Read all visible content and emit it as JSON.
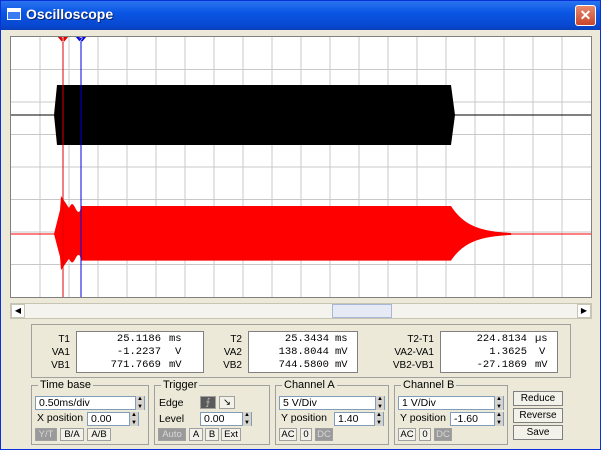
{
  "window": {
    "title": "Oscilloscope",
    "close": "✕"
  },
  "cursors": {
    "c1": "1",
    "c2": "2"
  },
  "readout": {
    "t1": {
      "labels": [
        "T1",
        "VA1",
        "VB1"
      ],
      "values": [
        [
          "25.1186",
          "ms"
        ],
        [
          "-1.2237",
          "V"
        ],
        [
          "771.7669",
          "mV"
        ]
      ]
    },
    "t2": {
      "labels": [
        "T2",
        "VA2",
        "VB2"
      ],
      "values": [
        [
          "25.3434",
          "ms"
        ],
        [
          "138.8044",
          "mV"
        ],
        [
          "744.5800",
          "mV"
        ]
      ]
    },
    "diff": {
      "labels": [
        "T2-T1",
        "VA2-VA1",
        "VB2-VB1"
      ],
      "values": [
        [
          "224.8134",
          "µs"
        ],
        [
          "1.3625",
          "V"
        ],
        [
          "-27.1869",
          "mV"
        ]
      ]
    }
  },
  "timebase": {
    "label": "Time base",
    "value": "0.50ms/div",
    "xpos_label": "X position",
    "xpos": "0.00",
    "buttons": [
      "Y/T",
      "B/A",
      "A/B"
    ]
  },
  "trigger": {
    "label": "Trigger",
    "edge_label": "Edge",
    "level_label": "Level",
    "level": "0.00",
    "buttons": [
      "Auto",
      "A",
      "B",
      "Ext"
    ]
  },
  "channel_a": {
    "label": "Channel A",
    "value": "5  V/Div",
    "ypos_label": "Y position",
    "ypos": "1.40",
    "buttons": [
      "AC",
      "0",
      "DC"
    ]
  },
  "channel_b": {
    "label": "Channel B",
    "value": "1  V/Div",
    "ypos_label": "Y position",
    "ypos": "-1.60",
    "buttons": [
      "AC",
      "0",
      "DC"
    ]
  },
  "actions": {
    "reduce": "Reduce",
    "reverse": "Reverse",
    "save": "Save"
  },
  "colors": {
    "trace_a": "#000000",
    "trace_b": "#FF0000",
    "cursor1": "#E00000",
    "cursor2": "#0000E0",
    "grid": "#C8C8C8"
  }
}
